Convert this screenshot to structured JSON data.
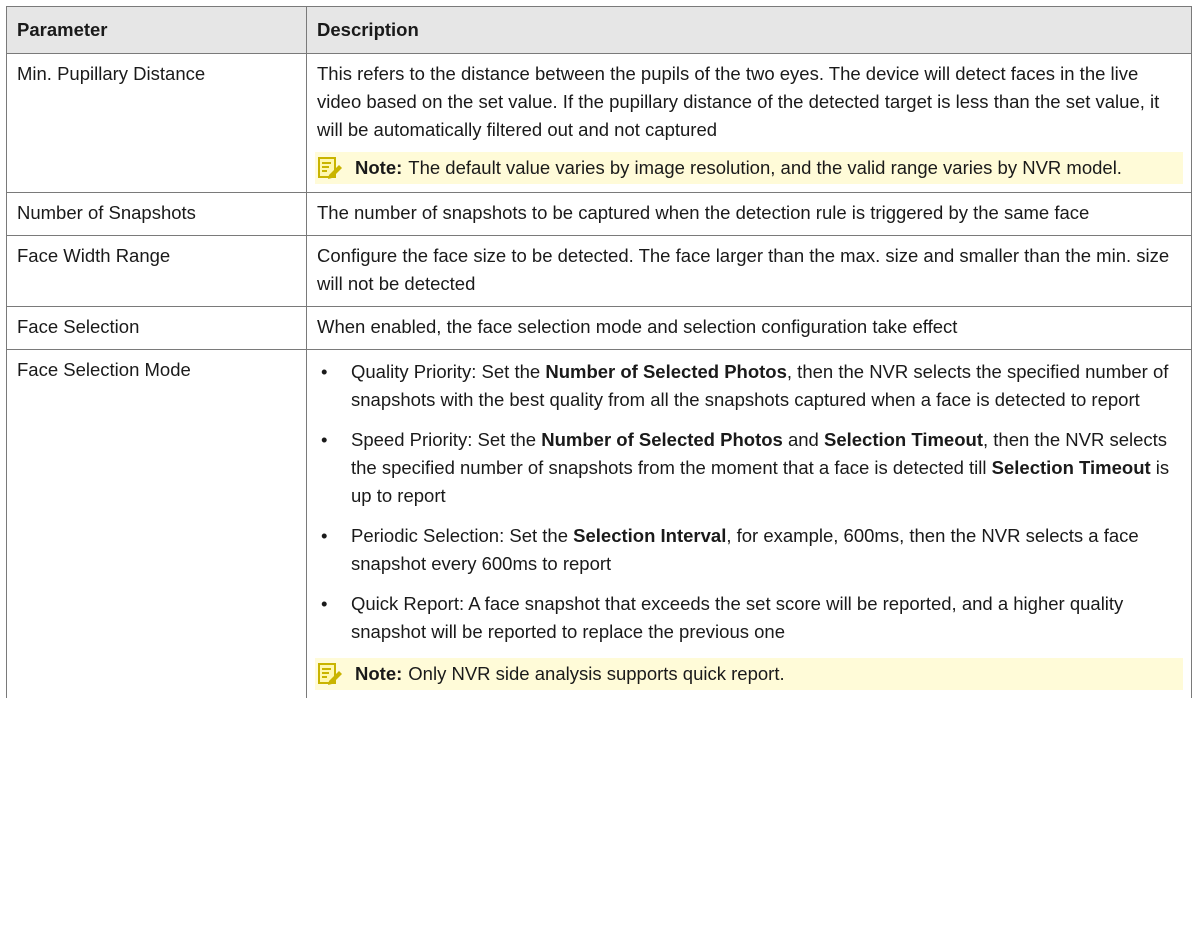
{
  "table": {
    "headers": {
      "parameter": "Parameter",
      "description": "Description"
    },
    "rows": [
      {
        "parameter": "Min. Pupillary Distance",
        "description": "This refers to the distance between the pupils of the two eyes. The device will detect faces in the live video based on the set value. If the pupillary distance of the detected target is less than the set value, it will be automatically filtered out and not captured",
        "note": {
          "label": "Note:",
          "text": "The default value varies by image resolution, and the valid range varies by NVR model."
        }
      },
      {
        "parameter": "Number of Snapshots",
        "description": "The number of snapshots to be captured when the detection rule is triggered by the same face"
      },
      {
        "parameter": "Face Width Range",
        "description": "Configure the face size to be detected. The face larger than the max. size and smaller than the min. size will not be detected"
      },
      {
        "parameter": "Face Selection",
        "description": "When enabled, the face selection mode and selection configuration take effect"
      },
      {
        "parameter": "Face Selection Mode",
        "bullets": [
          {
            "parts": [
              {
                "text": "Quality Priority: Set the ",
                "bold": false
              },
              {
                "text": "Number of Selected Photos",
                "bold": true
              },
              {
                "text": ", then the NVR selects the specified number of snapshots with the best quality from all the snapshots captured when a face is detected to report",
                "bold": false
              }
            ]
          },
          {
            "parts": [
              {
                "text": "Speed Priority: Set the ",
                "bold": false
              },
              {
                "text": "Number of Selected Photos",
                "bold": true
              },
              {
                "text": " and ",
                "bold": false
              },
              {
                "text": "Selection Timeout",
                "bold": true
              },
              {
                "text": ", then the NVR selects the specified number of snapshots from the moment that a face is detected till ",
                "bold": false
              },
              {
                "text": "Selection Timeout",
                "bold": true
              },
              {
                "text": " is up to report",
                "bold": false
              }
            ]
          },
          {
            "parts": [
              {
                "text": "Periodic Selection: Set the ",
                "bold": false
              },
              {
                "text": "Selection Interval",
                "bold": true
              },
              {
                "text": ", for example, 600ms, then the NVR selects a face snapshot every 600ms to report",
                "bold": false
              }
            ]
          },
          {
            "parts": [
              {
                "text": "Quick Report: A face snapshot that exceeds the set score will be reported, and a higher quality snapshot will be reported to replace the previous one",
                "bold": false
              }
            ]
          }
        ],
        "note": {
          "label": "Note:",
          "text": "Only NVR side analysis supports quick report."
        }
      }
    ]
  },
  "colors": {
    "header_bg": "#e6e6e6",
    "border": "#7a7a7a",
    "note_bg": "#fffbd8",
    "note_icon": "#c9b400"
  },
  "icons": {
    "note": "note-pencil-icon"
  }
}
